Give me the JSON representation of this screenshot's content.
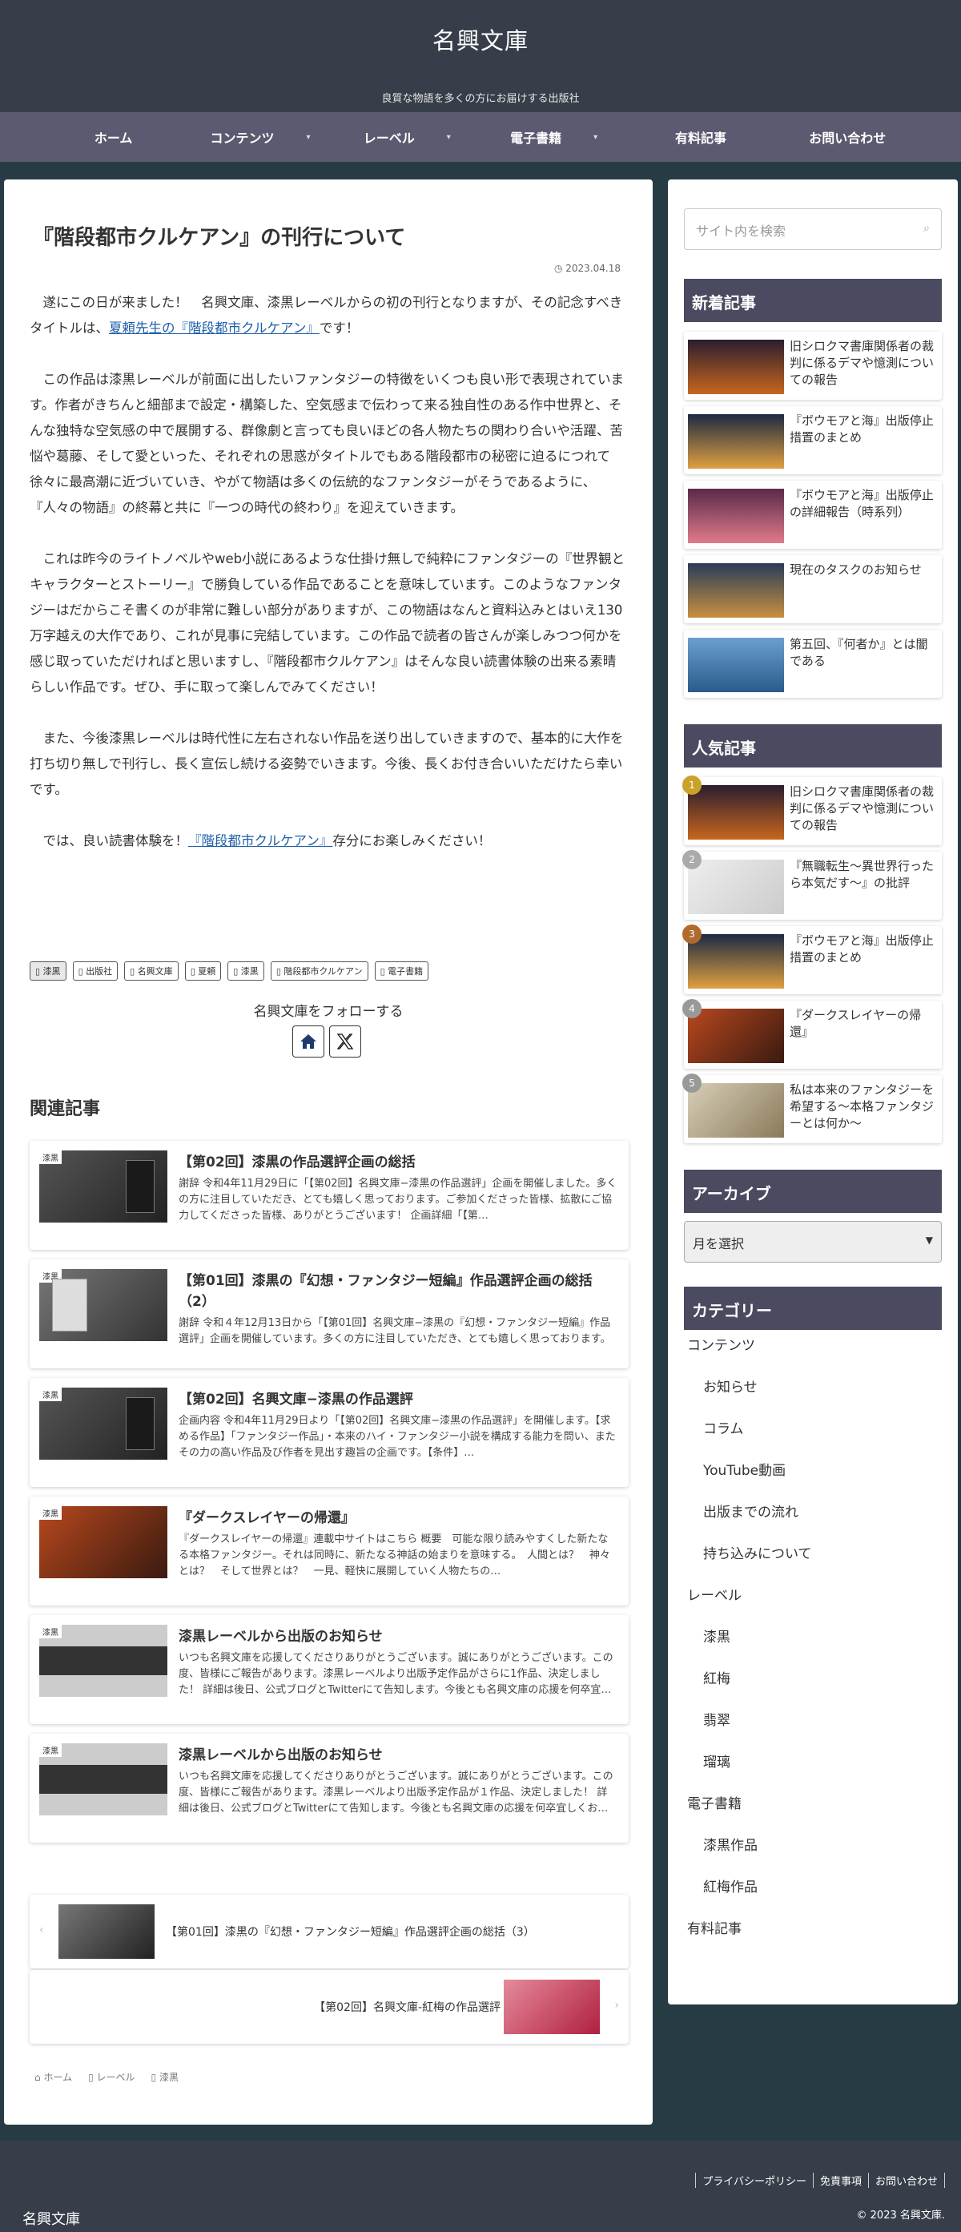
{
  "header": {
    "site_title": "名興文庫",
    "tagline": "良質な物語を多くの方にお届けする出版社"
  },
  "nav": [
    {
      "label": "ホーム",
      "has_chevron": false
    },
    {
      "label": "コンテンツ",
      "has_chevron": true
    },
    {
      "label": "レーベル",
      "has_chevron": true
    },
    {
      "label": "電子書籍",
      "has_chevron": true
    },
    {
      "label": "有料記事",
      "has_chevron": false
    },
    {
      "label": "お問い合わせ",
      "has_chevron": false
    }
  ],
  "article": {
    "title": "『階段都市クルケアン』の刊行について",
    "date": "2023.04.18",
    "p1_before": "遂にこの日が来ました！　名興文庫、漆黒レーベルからの初の刊行となりますが、その記念すべきタイトルは、",
    "p1_link": "夏頼先生の『階段都市クルケアン』",
    "p1_after": "です！",
    "p2": "この作品は漆黒レーベルが前面に出したいファンタジーの特徴をいくつも良い形で表現されています。作者がきちんと細部まで設定・構築した、空気感まで伝わって来る独自性のある作中世界と、そんな独特な空気感の中で展開する、群像劇と言っても良いほどの各人物たちの関わり合いや活躍、苦悩や葛藤、そして愛といった、それぞれの思惑がタイトルでもある階段都市の秘密に迫るにつれて徐々に最高潮に近づいていき、やがて物語は多くの伝統的なファンタジーがそうであるように、『人々の物語』の終幕と共に『一つの時代の終わり』を迎えていきます。",
    "p3": "これは昨今のライトノベルやweb小説にあるような仕掛け無しで純粋にファンタジーの『世界観とキャラクターとストーリー』で勝負している作品であることを意味しています。このようなファンタジーはだからこそ書くのが非常に難しい部分がありますが、この物語はなんと資料込みとはいえ130万字越えの大作であり、これが見事に完結しています。この作品で読者の皆さんが楽しみつつ何かを感じ取っていただければと思いますし、『階段都市クルケアン』はそんな良い読書体験の出来る素晴らしい作品です。ぜひ、手に取って楽しんでみてください！",
    "p4": "また、今後漆黒レーベルは時代性に左右されない作品を送り出していきますので、基本的に大作を打ち切り無しで刊行し、長く宣伝し続ける姿勢でいきます。今後、長くお付き合いいただけたら幸いです。",
    "p5_before": "では、良い読書体験を！",
    "p5_link": "『階段都市クルケアン』",
    "p5_after": "存分にお楽しみください！"
  },
  "tags": [
    {
      "label": "漆黒",
      "category": true
    },
    {
      "label": "出版社",
      "category": false
    },
    {
      "label": "名興文庫",
      "category": false
    },
    {
      "label": "夏頼",
      "category": false
    },
    {
      "label": "漆黒",
      "category": false
    },
    {
      "label": "階段都市クルケアン",
      "category": false
    },
    {
      "label": "電子書籍",
      "category": false
    }
  ],
  "follow": {
    "label": "名興文庫をフォローする",
    "home_icon": "home-icon",
    "x_icon": "x-logo-icon"
  },
  "related": {
    "heading": "関連記事",
    "items": [
      {
        "cat": "漆黒",
        "title": "【第02回】漆黒の作品選評企画の総括",
        "snippet": "謝辞 令和4年11月29日に「【第02回】名興文庫−漆黒の作品選評」企画を開催しました。多くの方に注目していただき、とても嬉しく思っております。ご参加くださった皆様、拡散にご協力してくださった皆様、ありがとうございます！ 企画詳細「【第…",
        "thumb": "shikkoku"
      },
      {
        "cat": "漆黒",
        "title": "【第01回】漆黒の『幻想・ファンタジー短編』作品選評企画の総括（2）",
        "snippet": "謝辞 令和４年12月13日から「【第01回】名興文庫−漆黒の『幻想・ファンタジー短編』作品選評」企画を開催しています。多くの方に注目していただき、とても嬉しく思っております。ご参加くださった皆様、拡散にご協力してくださった皆様、あり…",
        "thumb": "shikkoku-light"
      },
      {
        "cat": "漆黒",
        "title": "【第02回】名興文庫−漆黒の作品選評",
        "snippet": "企画内容 令和4年11月29日より「【第02回】名興文庫−漆黒の作品選評」を開催します。【求める作品】「ファンタジー作品」・本来のハイ・ファンタジー小説を構成する能力を問い、またその力の高い作品及び作者を見出す趣旨の企画です。【条件】…",
        "thumb": "shikkoku"
      },
      {
        "cat": "漆黒",
        "title": "『ダークスレイヤーの帰還』",
        "snippet": "『ダークスレイヤーの帰還』連載中サイトはこちら 概要　可能な限り読みやすくした新たなる本格ファンタジー。それは同時に、新たなる神話の始まりを意味する。　人間とは？　神々とは？　そして世界とは？　一見、軽快に展開していく人物たちの…",
        "thumb": "darkslayer"
      },
      {
        "cat": "漆黒",
        "title": "漆黒レーベルから出版のお知らせ",
        "snippet": "いつも名興文庫を応援してくださりありがとうございます。誠にありがとうございます。この度、皆様にご報告があります。漆黒レーベルより出版予定作品がさらに1作品、決定しました！ 詳細は後日、公式ブログとTwitterにて告知します。今後とも名興文庫の応援を何卒宜…",
        "thumb": "shikkoku-label"
      },
      {
        "cat": "漆黒",
        "title": "漆黒レーベルから出版のお知らせ",
        "snippet": "いつも名興文庫を応援してくださりありがとうございます。誠にありがとうございます。この度、皆様にご報告があります。漆黒レーベルより出版予定作品が１作品、決定しました！ 詳細は後日、公式ブログとTwitterにて告知します。今後とも名興文庫の応援を何卒宜しくお…",
        "thumb": "shikkoku-label"
      }
    ]
  },
  "pager": {
    "prev_title": "【第01回】漆黒の『幻想・ファンタジー短編』作品選評企画の総括（3）",
    "next_title": "【第02回】名興文庫-紅梅の作品選評"
  },
  "breadcrumb": [
    {
      "label": "ホーム",
      "icon": "home-icon"
    },
    {
      "label": "レーベル",
      "icon": "folder-icon"
    },
    {
      "label": "漆黒",
      "icon": "folder-icon"
    }
  ],
  "sidebar": {
    "search_placeholder": "サイト内を検索",
    "recent_title": "新着記事",
    "recent": [
      {
        "title": "旧シロクマ書庫関係者の裁判に係るデマや憶測についての報告",
        "thumb": "sunset"
      },
      {
        "title": "『ボウモアと海』出版停止措置のまとめ",
        "thumb": "bowmore"
      },
      {
        "title": "『ボウモアと海』出版停止の詳細報告（時系列）",
        "thumb": "bowmore-pink"
      },
      {
        "title": "現在のタスクのお知らせ",
        "thumb": "lake"
      },
      {
        "title": "第五回、『何者か』とは闇である",
        "thumb": "ship"
      }
    ],
    "popular_title": "人気記事",
    "popular": [
      {
        "rank": "1",
        "rank_color": "#c9a227",
        "title": "旧シロクマ書庫関係者の裁判に係るデマや憶測についての報告",
        "thumb": "sunset"
      },
      {
        "rank": "2",
        "rank_color": "#aaaaaa",
        "title": "『無職転生〜異世界行ったら本気だす〜』の批評",
        "thumb": "paid"
      },
      {
        "rank": "3",
        "rank_color": "#b06a2c",
        "title": "『ボウモアと海』出版停止措置のまとめ",
        "thumb": "bowmore"
      },
      {
        "rank": "4",
        "rank_color": "#999999",
        "title": "『ダークスレイヤーの帰還』",
        "thumb": "darkslayer"
      },
      {
        "rank": "5",
        "rank_color": "#999999",
        "title": "私は本来のファンタジーを希望する〜本格ファンタジーとは何か〜",
        "thumb": "compass"
      }
    ],
    "archive_title": "アーカイブ",
    "archive_select": "月を選択",
    "category_title": "カテゴリー",
    "categories": [
      {
        "label": "コンテンツ",
        "child": false
      },
      {
        "label": "お知らせ",
        "child": true
      },
      {
        "label": "コラム",
        "child": true
      },
      {
        "label": "YouTube動画",
        "child": true
      },
      {
        "label": "出版までの流れ",
        "child": true
      },
      {
        "label": "持ち込みについて",
        "child": true
      },
      {
        "label": "レーベル",
        "child": false
      },
      {
        "label": "漆黒",
        "child": true
      },
      {
        "label": "紅梅",
        "child": true
      },
      {
        "label": "翡翠",
        "child": true
      },
      {
        "label": "瑠璃",
        "child": true
      },
      {
        "label": "電子書籍",
        "child": false
      },
      {
        "label": "漆黒作品",
        "child": true
      },
      {
        "label": "紅梅作品",
        "child": true
      },
      {
        "label": "有料記事",
        "child": false
      }
    ]
  },
  "footer": {
    "links": [
      "プライバシーポリシー",
      "免責事項",
      "お問い合わせ"
    ],
    "copyright": "© 2023 名興文庫.",
    "brand": "名興文庫"
  }
}
